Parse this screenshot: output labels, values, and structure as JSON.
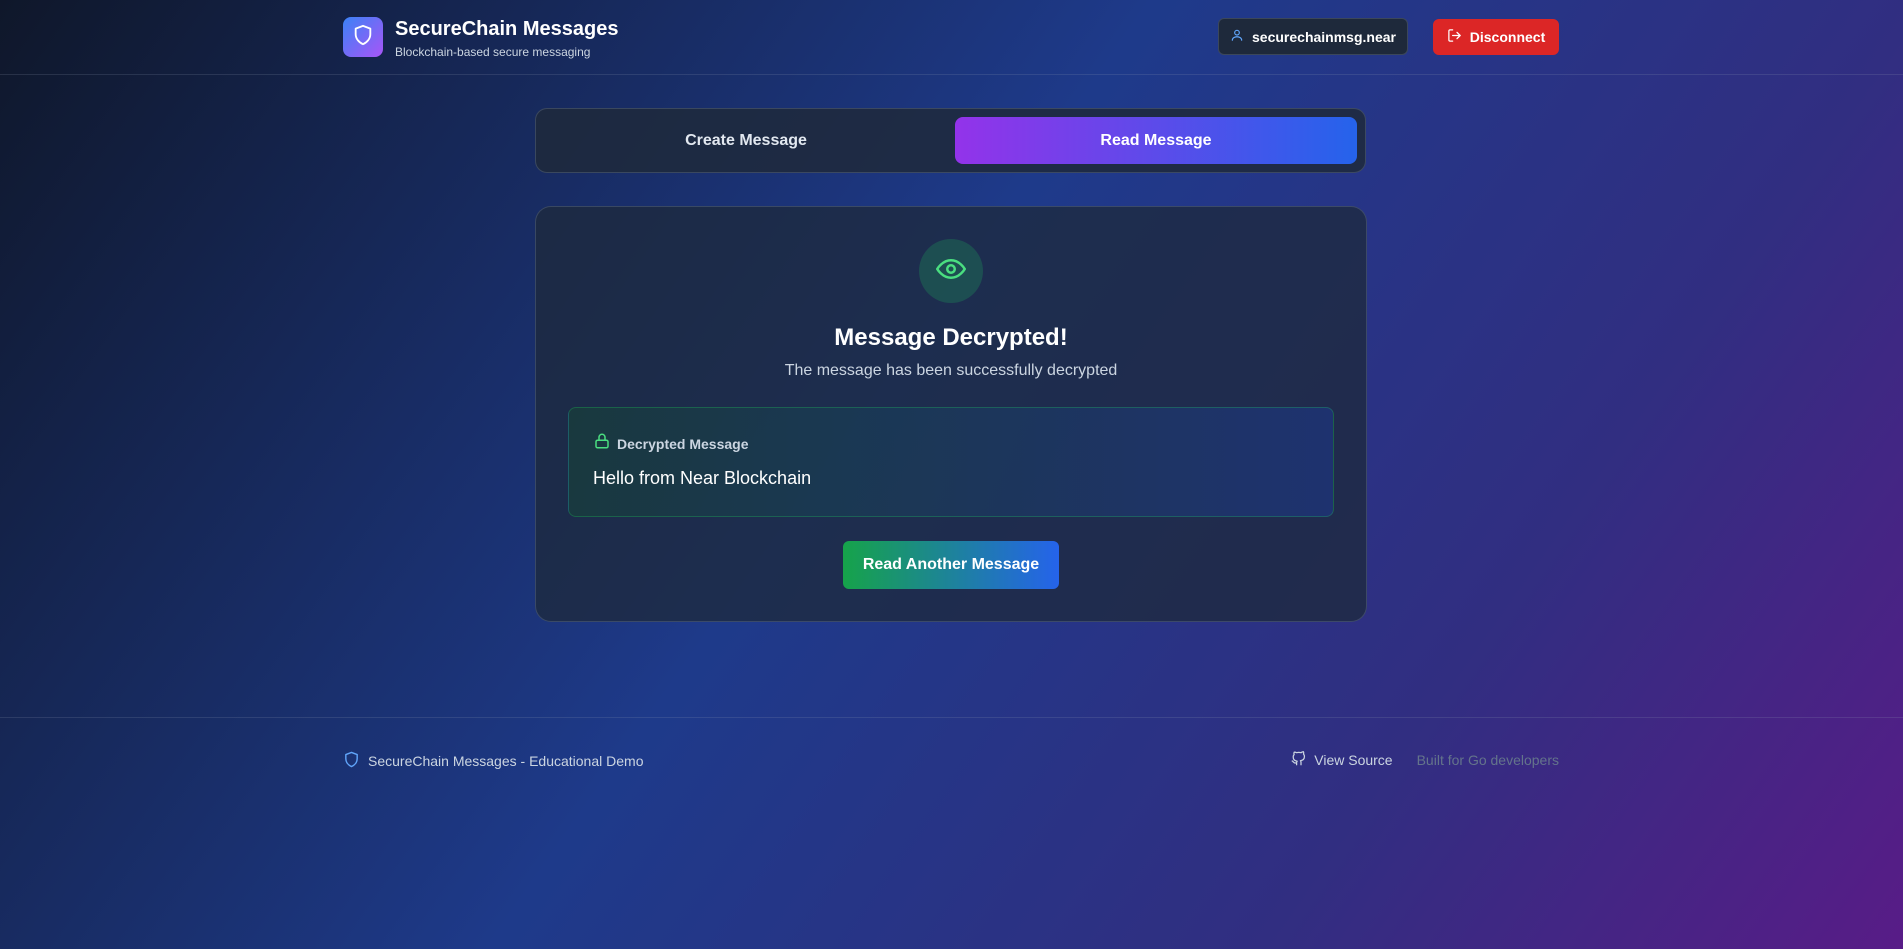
{
  "header": {
    "title": "SecureChain Messages",
    "subtitle": "Blockchain-based secure messaging",
    "account": "securechainmsg.near",
    "disconnect_label": "Disconnect"
  },
  "tabs": [
    {
      "label": "Create Message",
      "active": false
    },
    {
      "label": "Read Message",
      "active": true
    }
  ],
  "result": {
    "title": "Message Decrypted!",
    "subtitle": "The message has been successfully decrypted",
    "box_label": "Decrypted Message",
    "message": "Hello from Near Blockchain",
    "button_label": "Read Another Message"
  },
  "footer": {
    "left_text": "SecureChain Messages - Educational Demo",
    "view_source": "View Source",
    "built_for": "Built for Go developers"
  },
  "colors": {
    "accent_purple": "#9333ea",
    "accent_blue": "#2563eb",
    "success_green": "#16a34a",
    "danger_red": "#dc2626"
  },
  "icons": {
    "logo": "shield-icon",
    "account": "user-icon",
    "disconnect": "logout-icon",
    "status": "eye-icon",
    "box": "lock-icon",
    "footer": "shield-icon",
    "source": "github-icon"
  }
}
